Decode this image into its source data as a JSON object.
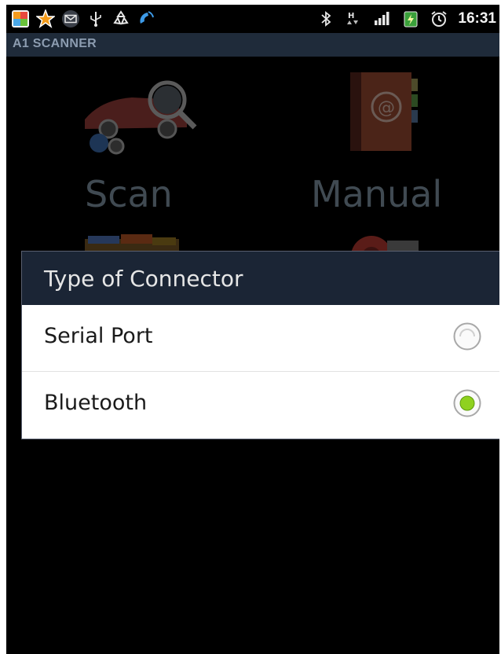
{
  "status_bar": {
    "time": "16:31",
    "icons_left": [
      "photos-icon",
      "star-icon",
      "mail-icon",
      "usb-icon",
      "recycle-icon",
      "phone-call-icon"
    ],
    "icons_right": [
      "bluetooth-icon",
      "data-arrows-icon",
      "signal-icon",
      "battery-icon",
      "alarm-icon"
    ]
  },
  "app": {
    "title": "A1 SCANNER"
  },
  "menu": {
    "scan_label": "Scan",
    "manual_label": "Manual"
  },
  "dialog": {
    "title": "Type of Connector",
    "options": [
      {
        "label": "Serial Port",
        "selected": false
      },
      {
        "label": "Bluetooth",
        "selected": true
      }
    ],
    "accent_color": "#8fd11f"
  }
}
